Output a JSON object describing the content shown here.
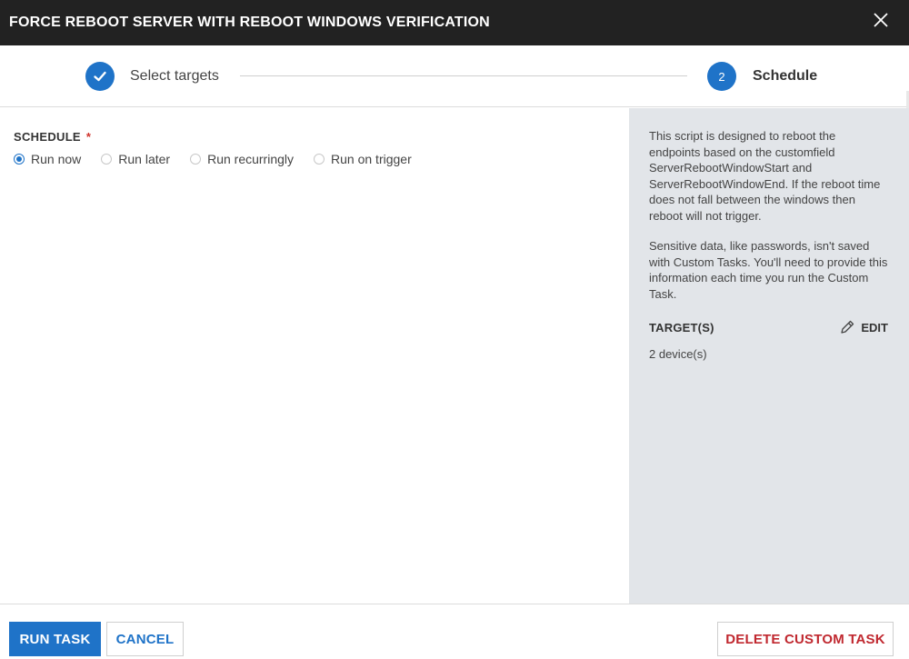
{
  "dialog": {
    "title": "FORCE REBOOT SERVER WITH REBOOT WINDOWS VERIFICATION",
    "close_icon": "close-icon"
  },
  "stepper": {
    "steps": [
      {
        "label": "Select targets",
        "state": "completed",
        "icon": "check-icon"
      },
      {
        "number": "2",
        "label": "Schedule",
        "state": "active"
      }
    ]
  },
  "schedule": {
    "label": "SCHEDULE",
    "required_mark": "*",
    "options": [
      {
        "label": "Run now",
        "selected": true
      },
      {
        "label": "Run later",
        "selected": false
      },
      {
        "label": "Run recurringly",
        "selected": false
      },
      {
        "label": "Run on trigger",
        "selected": false
      }
    ]
  },
  "sidebar": {
    "description": "This script is designed to reboot the endpoints based on the customfield ServerRebootWindowStart and ServerRebootWindowEnd. If the reboot time does not fall between the windows then reboot will not trigger.",
    "notice": "Sensitive data, like passwords, isn't saved with Custom Tasks. You'll need to provide this information each time you run the Custom Task.",
    "targets_title": "TARGET(S)",
    "edit_label": "EDIT",
    "edit_icon": "pencil-icon",
    "targets_count": "2 device(s)"
  },
  "footer": {
    "run_label": "RUN TASK",
    "cancel_label": "CANCEL",
    "delete_label": "DELETE CUSTOM TASK"
  },
  "colors": {
    "accent": "#1f73c8",
    "titlebar": "#222222",
    "danger": "#c0282f",
    "sidebar_bg": "#e2e5e9"
  }
}
